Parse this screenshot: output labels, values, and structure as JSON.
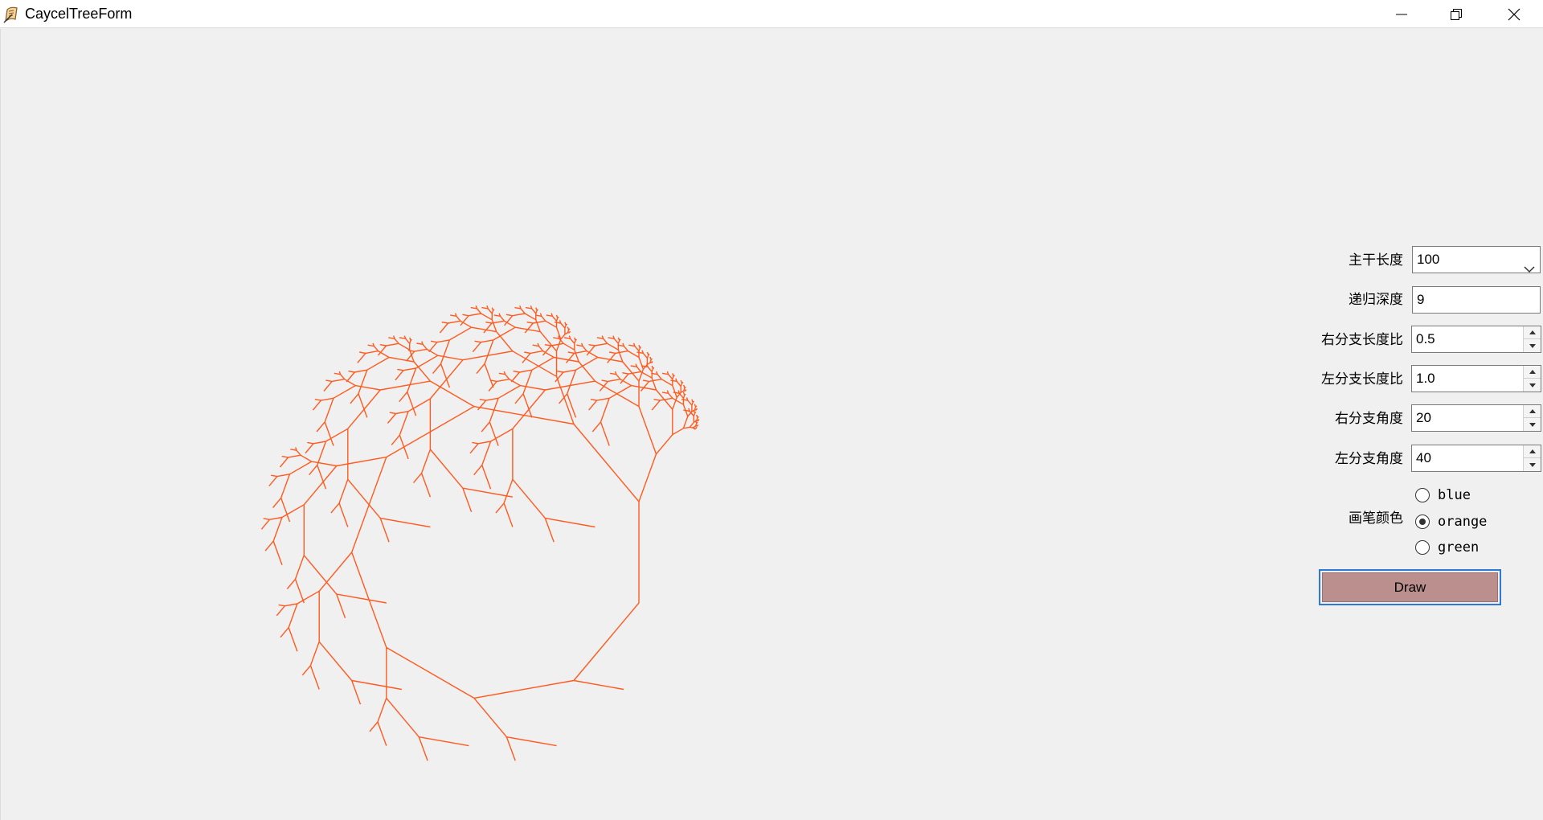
{
  "window": {
    "title": "CaycelTreeForm",
    "icon": "app-paper-quill-icon",
    "controls": [
      "minimize-icon",
      "restore-icon",
      "close-icon"
    ]
  },
  "controls": {
    "trunk_length": {
      "label": "主干长度",
      "value": "100",
      "icon": "chevron-down-icon"
    },
    "recursion_depth": {
      "label": "递归深度",
      "value": "9"
    },
    "right_ratio": {
      "label": "右分支长度比",
      "value": "0.5"
    },
    "left_ratio": {
      "label": "左分支长度比",
      "value": "1.0"
    },
    "right_angle": {
      "label": "右分支角度",
      "value": "20"
    },
    "left_angle": {
      "label": "左分支角度",
      "value": "40"
    },
    "pen_color": {
      "label": "画笔颜色",
      "options": [
        "blue",
        "orange",
        "green"
      ],
      "selected": "orange"
    },
    "draw_button": {
      "label": "Draw",
      "color": "#bc8f8f"
    }
  },
  "tree": {
    "color": "#ff5a1f",
    "trunk_length": 100,
    "depth": 9,
    "right_ratio": 0.5,
    "left_ratio": 1.0,
    "right_angle": 20,
    "left_angle": 40
  }
}
